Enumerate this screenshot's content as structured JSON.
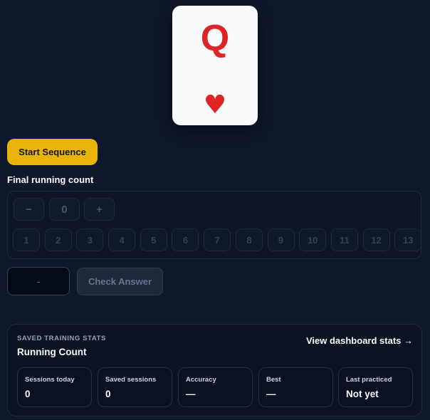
{
  "card": {
    "rank": "Q",
    "suit": "♥"
  },
  "controls": {
    "start_label": "Start Sequence"
  },
  "count": {
    "label": "Final running count",
    "decrement": "−",
    "value": "0",
    "increment": "+",
    "numbers": [
      "1",
      "2",
      "3",
      "4",
      "5",
      "6",
      "7",
      "8",
      "9",
      "10",
      "11",
      "12",
      "13"
    ]
  },
  "answer": {
    "placeholder": "-",
    "check_label": "Check Answer"
  },
  "stats": {
    "kicker": "SAVED TRAINING STATS",
    "title": "Running Count",
    "link": "View dashboard stats →",
    "boxes": [
      {
        "label": "Sessions today",
        "value": "0"
      },
      {
        "label": "Saved sessions",
        "value": "0"
      },
      {
        "label": "Accuracy",
        "value": "—"
      },
      {
        "label": "Best",
        "value": "—"
      },
      {
        "label": "Last practiced",
        "value": "Not yet"
      }
    ]
  }
}
